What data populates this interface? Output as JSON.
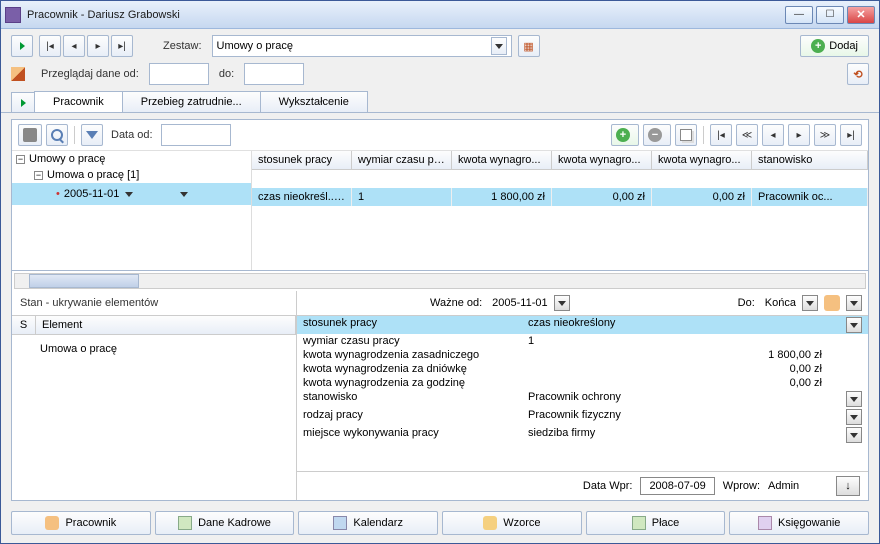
{
  "window": {
    "title": "Pracownik - Dariusz Grabowski"
  },
  "toolbar": {
    "zestaw_label": "Zestaw:",
    "zestaw_value": "Umowy o pracę",
    "dodaj_label": "Dodaj",
    "browse_label": "Przeglądaj dane od:",
    "do_label": "do:"
  },
  "tabs": {
    "t1": "Pracownik",
    "t2": "Przebieg zatrudnie...",
    "t3": "Wykształcenie"
  },
  "panel": {
    "data_od_label": "Data od:"
  },
  "tree": {
    "root": "Umowy o pracę",
    "child": "Umowa o pracę [1]",
    "leaf_date": "2005-11-01"
  },
  "columns": {
    "c1": "stosunek pracy",
    "c2": "wymiar czasu pr...",
    "c3": "kwota wynagro...",
    "c4": "kwota wynagro...",
    "c5": "kwota wynagro...",
    "c6": "stanowisko"
  },
  "row": {
    "c1": "czas nieokreśl...",
    "c2": "1",
    "c3": "1 800,00 zł",
    "c4": "0,00 zł",
    "c5": "0,00 zł",
    "c6": "Pracownik oc..."
  },
  "lowerLeft": {
    "header": "Stan - ukrywanie elementów",
    "col_s": "S",
    "col_el": "Element",
    "item": "Umowa o pracę"
  },
  "detail": {
    "wazne_od_label": "Ważne od:",
    "wazne_od_value": "2005-11-01",
    "do_label": "Do:",
    "do_value": "Końca",
    "rows": [
      {
        "k": "stosunek pracy",
        "v": "czas nieokreślony",
        "dd": true,
        "sel": true
      },
      {
        "k": "wymiar czasu pracy",
        "v": "1"
      },
      {
        "k": "kwota wynagrodzenia zasadniczego",
        "v": "1 800,00 zł",
        "right": true
      },
      {
        "k": "kwota wynagrodzenia za dniówkę",
        "v": "0,00 zł",
        "right": true
      },
      {
        "k": "kwota wynagrodzenia za godzinę",
        "v": "0,00 zł",
        "right": true
      },
      {
        "k": "stanowisko",
        "v": "Pracownik ochrony",
        "dd": true
      },
      {
        "k": "rodzaj pracy",
        "v": "Pracownik fizyczny",
        "dd": true
      },
      {
        "k": "miejsce wykonywania pracy",
        "v": "siedziba firmy",
        "dd": true
      }
    ],
    "data_wpr_label": "Data Wpr:",
    "data_wpr_value": "2008-07-09",
    "wprow_label": "Wprow:",
    "wprow_value": "Admin"
  },
  "bottomTabs": {
    "t1": "Pracownik",
    "t2": "Dane Kadrowe",
    "t3": "Kalendarz",
    "t4": "Wzorce",
    "t5": "Płace",
    "t6": "Księgowanie"
  }
}
